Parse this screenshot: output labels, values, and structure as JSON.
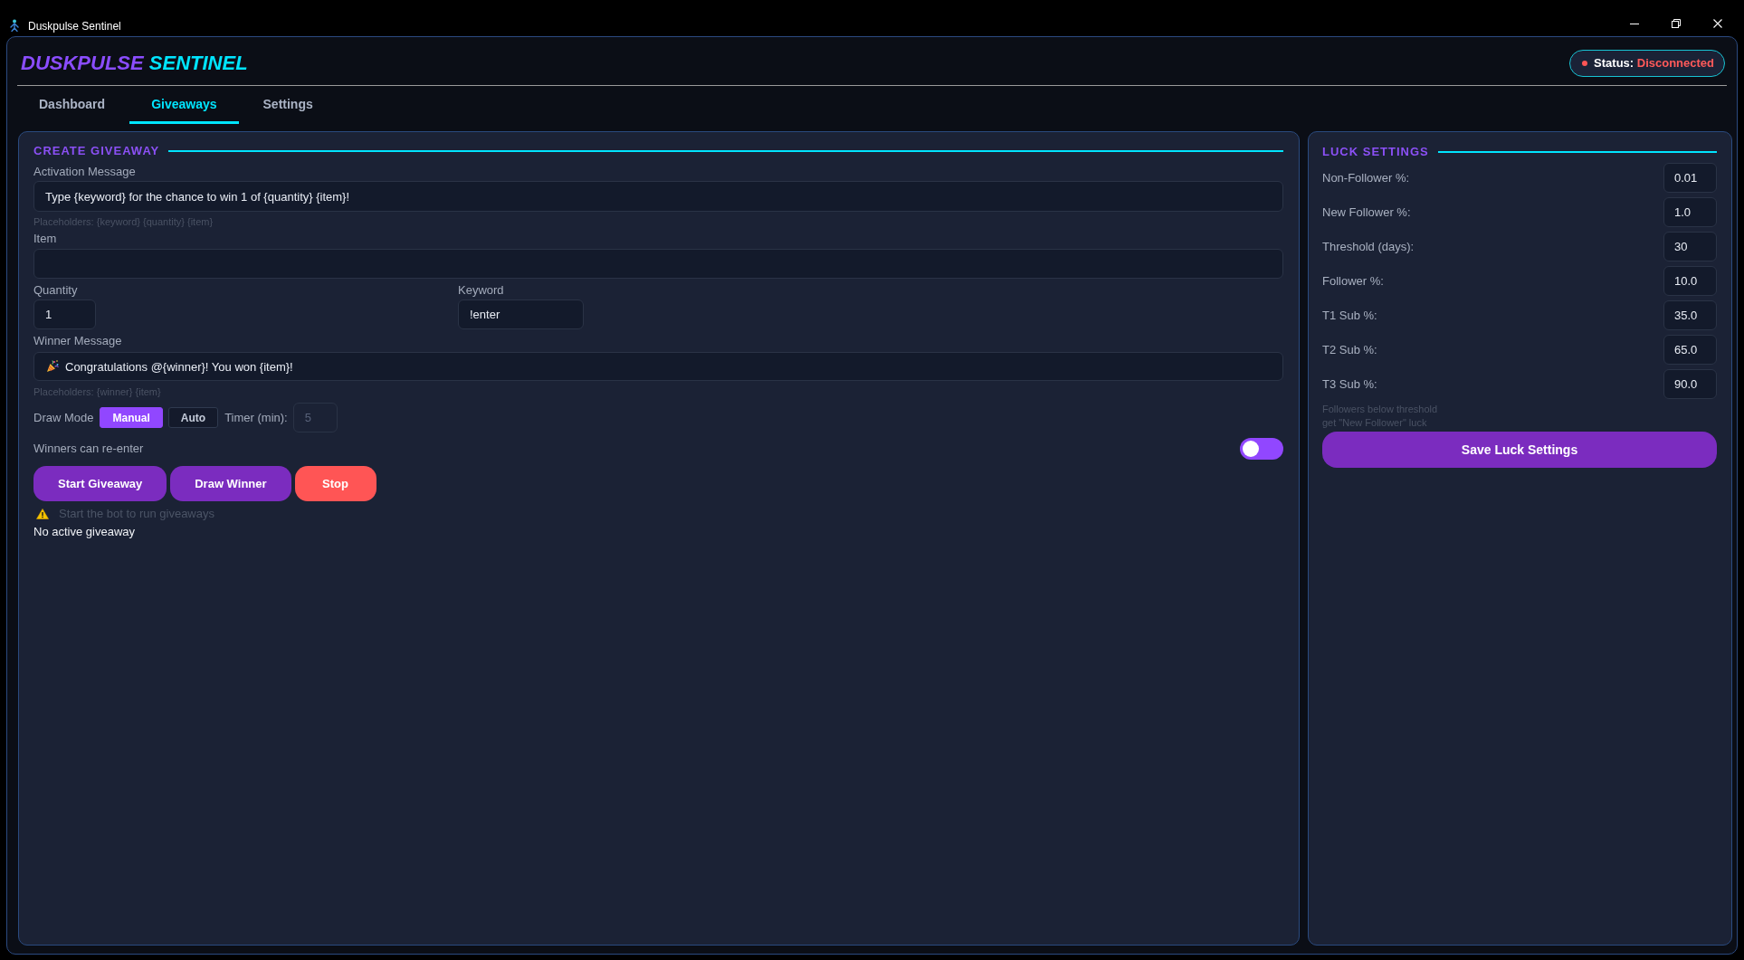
{
  "window": {
    "title": "Duskpulse Sentinel"
  },
  "header": {
    "title": [
      {
        "text": "DUSKPULSE",
        "kind": "primary"
      },
      {
        "text": "SENTINEL",
        "kind": "accent"
      }
    ],
    "status": {
      "label": "Status:",
      "value": "Disconnected",
      "connected": false
    }
  },
  "tabs": [
    {
      "label": "Dashboard",
      "selected": false
    },
    {
      "label": "Giveaways",
      "selected": true
    },
    {
      "label": "Settings",
      "selected": false
    }
  ],
  "create_giveaway": {
    "heading": "CREATE GIVEAWAY",
    "activation_message": {
      "label": "Activation Message",
      "value": "Type {keyword} for the chance to win 1 of {quantity} {item}!",
      "hint": "Placeholders: {keyword} {quantity} {item}"
    },
    "item": {
      "label": "Item"
    },
    "quantity": {
      "label": "Quantity",
      "value": "1"
    },
    "keyword": {
      "label": "Keyword",
      "value": "!enter"
    },
    "winner_message": {
      "label": "Winner Message",
      "value": "Congratulations @{winner}! You won {item}!",
      "hint": "Placeholders: {winner} {item}"
    },
    "draw_mode": {
      "label": "Draw Mode",
      "options": [
        {
          "label": "Manual",
          "selected": true
        },
        {
          "label": "Auto",
          "selected": false
        }
      ]
    },
    "timer": {
      "label": "Timer (min):",
      "value": "5",
      "disabled": true
    },
    "reenter": {
      "label": "Winners can re-enter",
      "on": false
    },
    "buttons": [
      {
        "label": "Start Giveaway",
        "kind": "primary"
      },
      {
        "label": "Draw Winner",
        "kind": "primary"
      },
      {
        "label": "Stop",
        "kind": "danger"
      }
    ],
    "warning": "Start the bot to run giveaways",
    "giveaway_status": "No active giveaway"
  },
  "luck_settings": {
    "heading": "LUCK SETTINGS",
    "rows": [
      {
        "label": "Non-Follower %:",
        "value": "0.01"
      },
      {
        "label": "New Follower %:",
        "value": "1.0"
      },
      {
        "label": "Threshold (days):",
        "value": "30"
      },
      {
        "label": "Follower %:",
        "value": "10.0"
      },
      {
        "label": "T1 Sub %:",
        "value": "35.0"
      },
      {
        "label": "T2 Sub %:",
        "value": "65.0"
      },
      {
        "label": "T3 Sub %:",
        "value": "90.0"
      }
    ],
    "note": "Followers below threshold get \"New Follower\" luck",
    "button": "Save Luck Settings"
  }
}
